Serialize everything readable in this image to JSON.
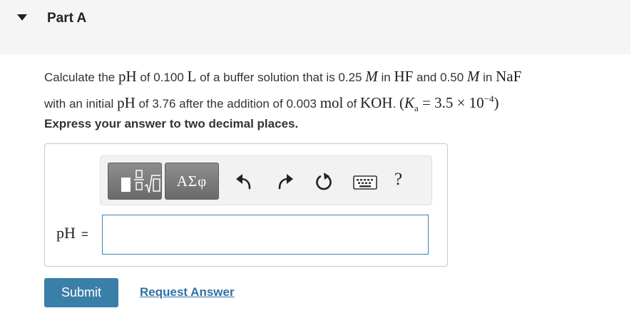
{
  "part": {
    "title": "Part A"
  },
  "question": {
    "t1": "Calculate the ",
    "pH": "pH",
    "t2": " of 0.100 ",
    "L": "L",
    "t3": " of a buffer solution that is 0.25 ",
    "M": "M",
    "t4": " in ",
    "HF": "HF",
    "t5": " and 0.50 ",
    "t6": " in ",
    "NaF": "NaF",
    "t7": "with an initial ",
    "t8": " of 3.76 after the addition of 0.003 ",
    "mol": "mol",
    "t9": " of ",
    "KOH": "KOH",
    "t10": ". ",
    "ka_open": "(",
    "K": "K",
    "a": "a",
    "ka_eq": " = 3.5 × 10",
    "ka_exp": "−4",
    "ka_close": ")"
  },
  "instruction": "Express your answer to two decimal places.",
  "toolbar": {
    "symbols_label": "ΑΣφ",
    "help_label": "?"
  },
  "answer": {
    "label": "pH",
    "equals": "=",
    "value": "",
    "placeholder": ""
  },
  "actions": {
    "submit_label": "Submit",
    "request_label": "Request Answer"
  },
  "colors": {
    "header_bg": "#f5f5f5",
    "submit_bg": "#3a7fa8",
    "link": "#2e72a6",
    "input_border": "#3d83b5",
    "toolbar_button": "#7a7a7a"
  }
}
